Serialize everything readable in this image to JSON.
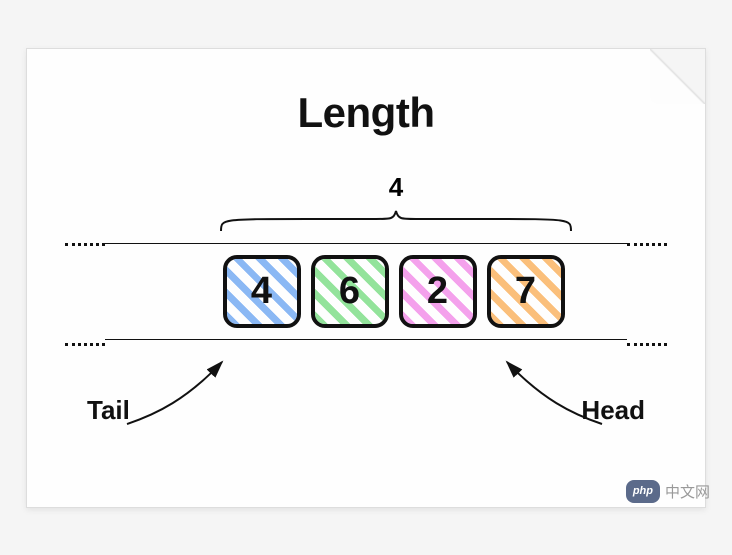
{
  "title": "Length",
  "length_value": "4",
  "nodes": [
    {
      "value": "4",
      "color": "blue"
    },
    {
      "value": "6",
      "color": "green"
    },
    {
      "value": "2",
      "color": "pink"
    },
    {
      "value": "7",
      "color": "orange"
    }
  ],
  "tail_label": "Tail",
  "head_label": "Head",
  "watermark": {
    "badge": "php",
    "text": "中文网"
  },
  "chart_data": {
    "type": "table",
    "title": "Length",
    "description": "Queue / list diagram with 4 elements. Tail points to first element (4), Head points to last element (7). Length = 4.",
    "elements": [
      4,
      6,
      2,
      7
    ],
    "length": 4,
    "tail_index": 0,
    "head_index": 3
  }
}
